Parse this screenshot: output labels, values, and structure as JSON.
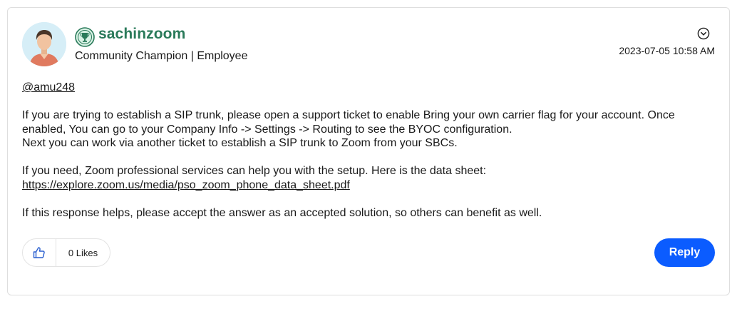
{
  "author": {
    "name": "sachinzoom",
    "rank": "Community Champion | Employee",
    "avatar_icon": "user-avatar",
    "badge_icon": "trophy-icon",
    "name_color": "#2a7a5a"
  },
  "post": {
    "date": "2023-07-05 10:58 AM",
    "mention": "@amu248",
    "paragraph1_line1": "If you are trying to establish a SIP trunk, please open a support ticket to enable Bring your own carrier flag for your account.  Once",
    "paragraph1_line2": "enabled, You can go to your Company Info -> Settings -> Routing to see the BYOC configuration.",
    "paragraph1_line3": "Next you can work via another ticket to establish a SIP trunk to Zoom from your SBCs.",
    "paragraph2": "If you need, Zoom professional services can help you with the setup. Here is the data sheet:",
    "link": "https://explore.zoom.us/media/pso_zoom_phone_data_sheet.pdf",
    "paragraph3": "If this response helps, please accept the answer as an accepted solution, so others can benefit as well."
  },
  "actions": {
    "options_icon": "chevron-down-circle-icon",
    "kudos_icon": "thumbs-up-icon",
    "kudos_label": "0 Likes",
    "reply_label": "Reply",
    "reply_color": "#0b5cff"
  }
}
